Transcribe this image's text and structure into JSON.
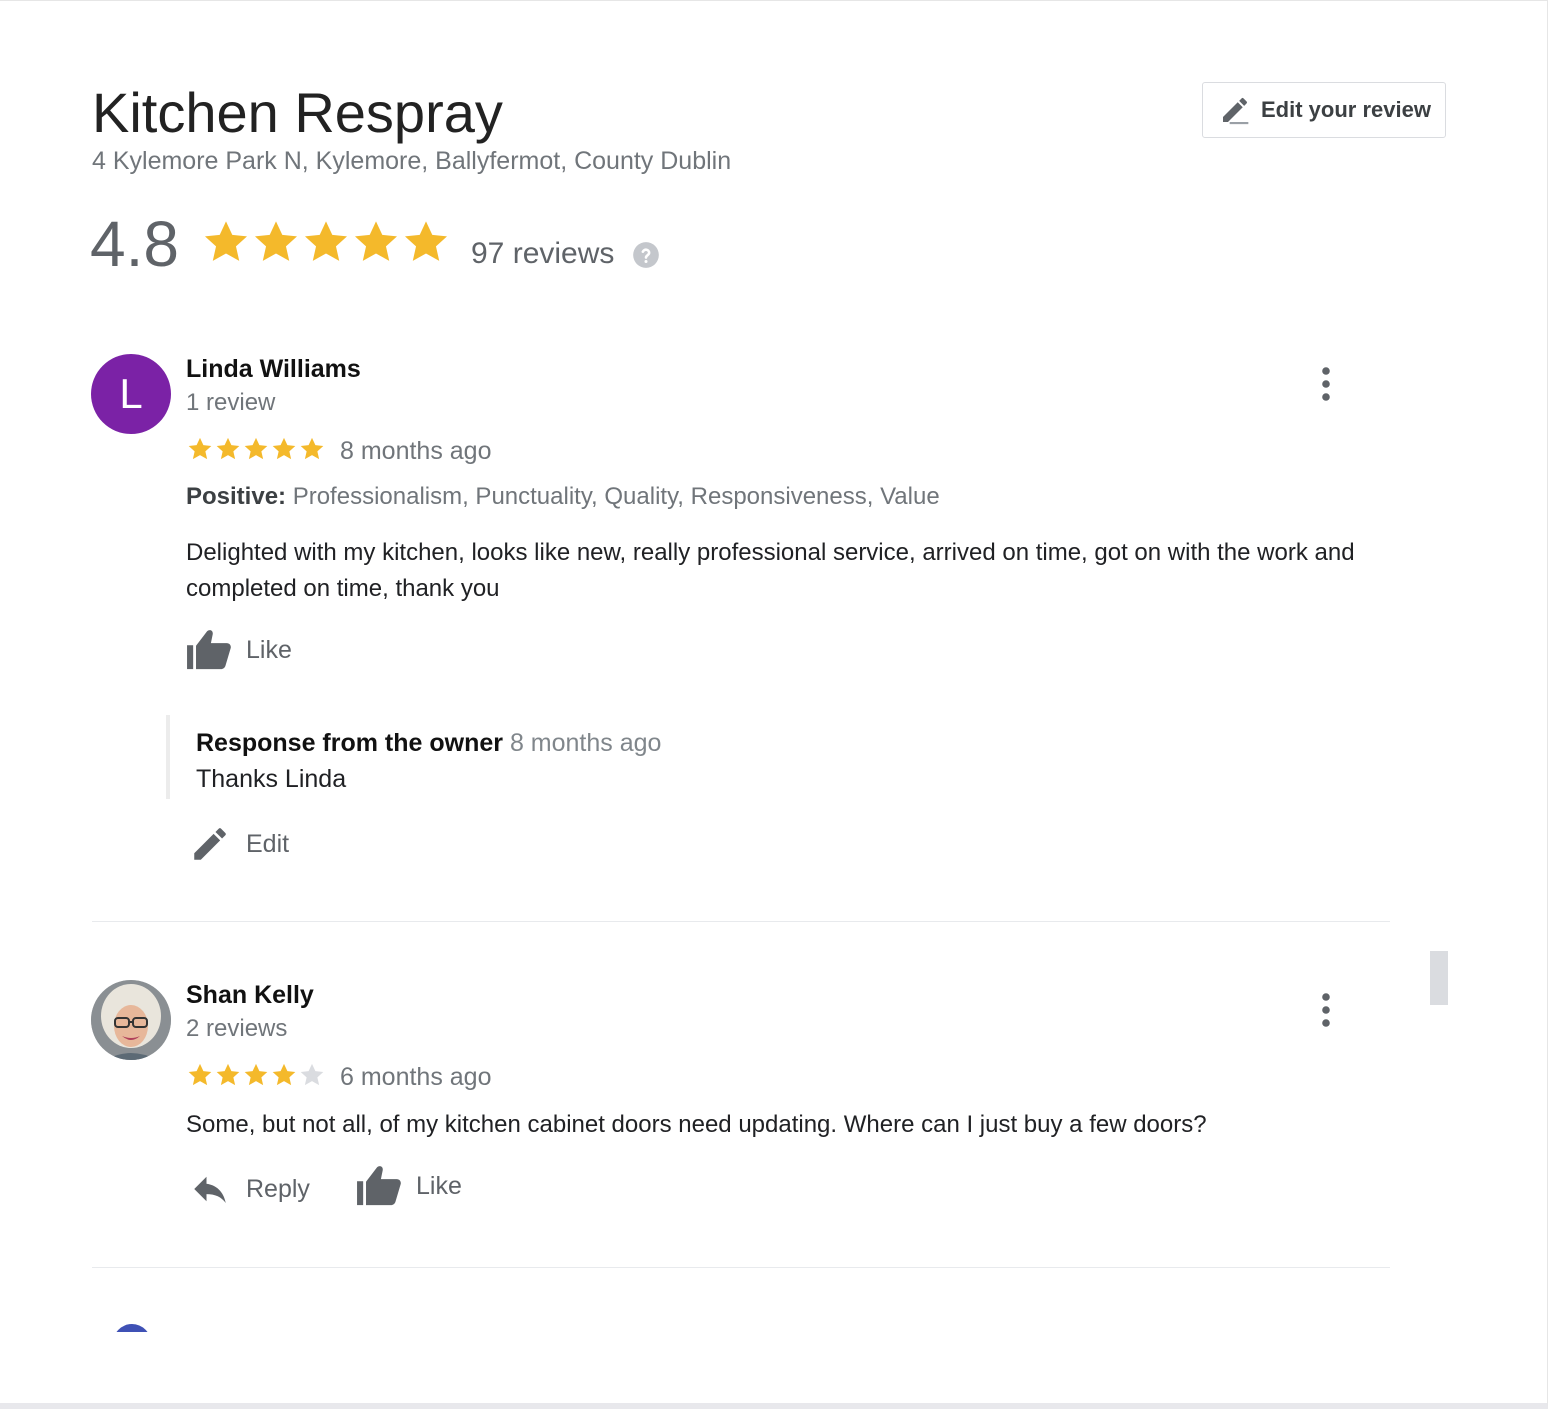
{
  "business": {
    "name": "Kitchen Respray",
    "address": "4 Kylemore Park N, Kylemore, Ballyfermot, County Dublin",
    "rating": "4.8",
    "rating_value": 4.8,
    "review_count_label": "97 reviews"
  },
  "edit_review_button": {
    "label": "Edit your review",
    "icon": "pencil-icon"
  },
  "colors": {
    "star_filled": "#f4b92b",
    "star_empty": "#dadce0",
    "avatar_linda": "#7b22a6",
    "text_secondary": "#70757a"
  },
  "reviews": [
    {
      "author": "Linda Williams",
      "avatar_initial": "L",
      "author_reviews": "1 review",
      "stars": 5,
      "time": "8 months ago",
      "attributes_label": "Positive:",
      "attributes": "Professionalism, Punctuality, Quality, Responsiveness, Value",
      "text": "Delighted with my kitchen, looks like new, really professional service, arrived on time, got on with the work and completed on time, thank you",
      "like_label": "Like",
      "owner_response": {
        "heading": "Response from the owner",
        "time": "8 months ago",
        "text": "Thanks Linda",
        "edit_label": "Edit"
      }
    },
    {
      "author": "Shan Kelly",
      "author_reviews": "2 reviews",
      "stars": 4,
      "time": "6 months ago",
      "text": "Some, but not all, of my kitchen cabinet doors need updating. Where can I just buy a few doors?",
      "reply_label": "Reply",
      "like_label": "Like"
    }
  ]
}
